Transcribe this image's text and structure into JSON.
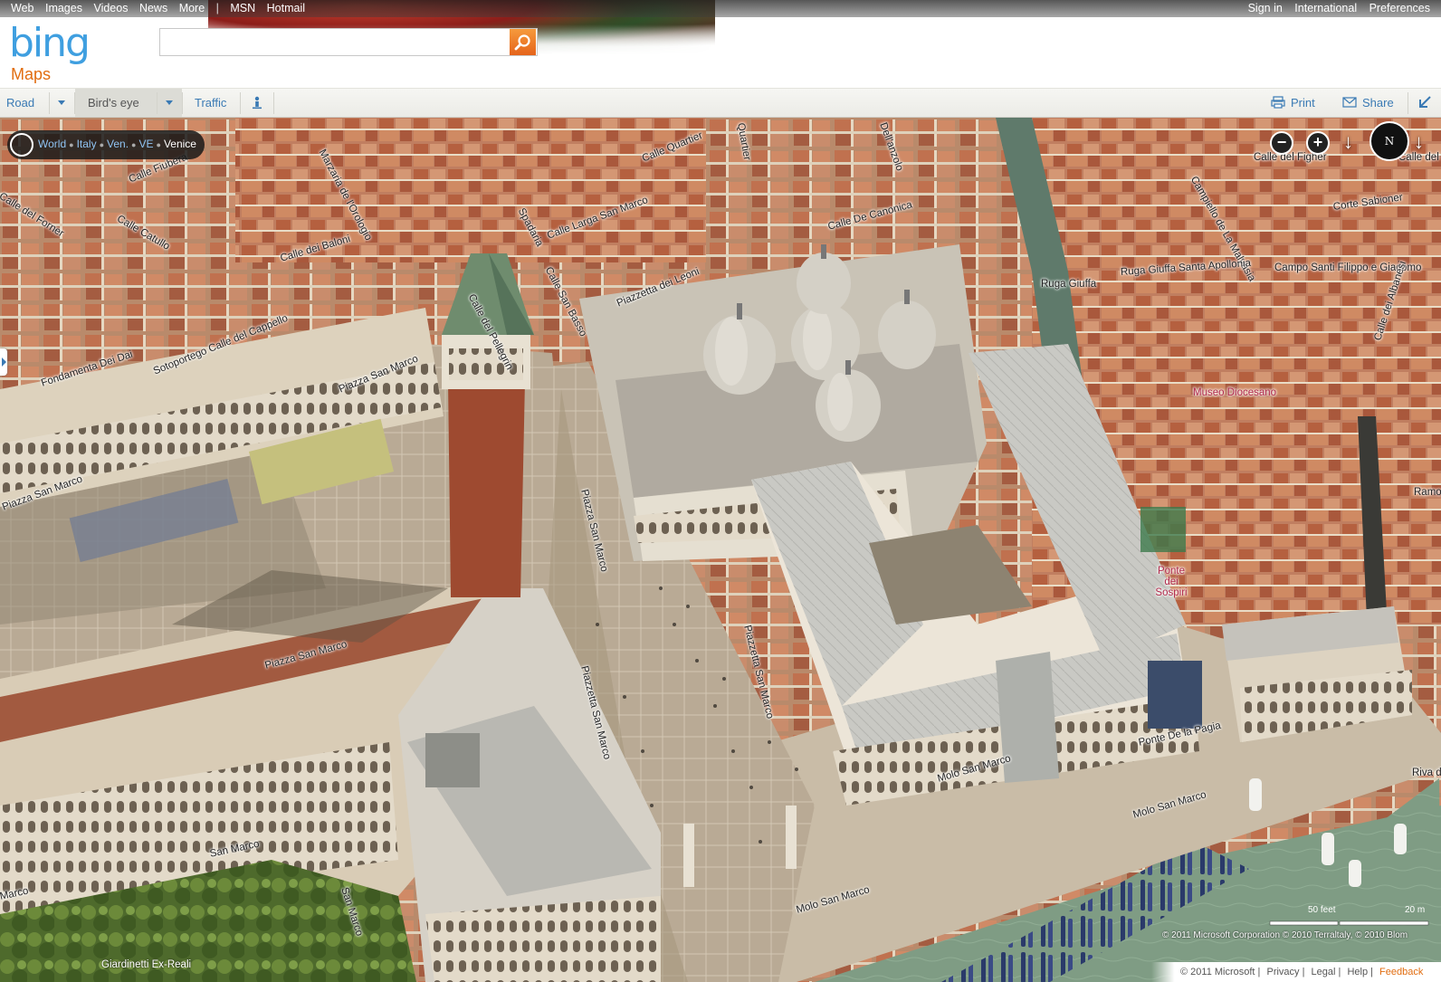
{
  "header": {
    "top_links_left": [
      "Web",
      "Images",
      "Videos",
      "News",
      "More",
      "|",
      "MSN",
      "Hotmail"
    ],
    "top_links_right": [
      "Sign in",
      "International",
      "Preferences"
    ],
    "logo": "bing",
    "product": "Maps",
    "search": {
      "value": "",
      "placeholder": ""
    }
  },
  "toolbar": {
    "road": "Road",
    "birdseye": "Bird's eye",
    "traffic": "Traffic",
    "print": "Print",
    "share": "Share"
  },
  "breadcrumb": {
    "items": [
      "World",
      "Italy",
      "Ven.",
      "VE"
    ],
    "current": "Venice"
  },
  "map": {
    "labels": [
      "Calle Fiubera",
      "Calle del Forner",
      "Calle Catullo",
      "Marzaria de l'Orologio",
      "Spadaria",
      "Calle Quartier",
      "Quartier",
      "Dell'anzolo",
      "Calle del Figher",
      "Calle del F",
      "Campiello de La Malvasia",
      "Corte Sabioner",
      "Calle dei Baloni",
      "Calle Larga San Marco",
      "Calle San Basso",
      "Calle De Canonica",
      "Ruga Giuffa",
      "Ruga Giuffa Santa Apollonia",
      "Campo Santi Filippo e Giacomo",
      "Calle del Pellegrin",
      "Piazzetta dei Leoni",
      "Sotoportego Calle del Cappello",
      "Fondamenta Dei Dai",
      "Piazza San Marco",
      "Piazza San Marco",
      "Piazza San Marco",
      "Calle dei Albanesi",
      "Ramo D",
      "Piazza San Marco",
      "Piazzetta San Marco",
      "Piazzetta San Marco",
      "Ponte De la Pagia",
      "Molo San Marco",
      "Molo San Marco",
      "Riva de",
      "San Marco",
      "Marco",
      "San Marco",
      "Molo San Marco",
      "Giardinetti Ex-Reali"
    ],
    "pois": [
      "Museo Diocesano",
      "Ponte dei Sospiri"
    ],
    "scale_feet": "50 feet",
    "scale_m": "20 m",
    "copyright": "© 2011 Microsoft Corporation   © 2010 Terraltaly, © 2010 Blom"
  },
  "footer": {
    "copyright": "© 2011 Microsoft",
    "links": [
      "Privacy",
      "Legal",
      "Help"
    ],
    "feedback": "Feedback"
  },
  "colors": {
    "accent": "#e16d10",
    "link": "#3a7ab4",
    "bing_blue": "#3f9fe0"
  },
  "icons": [
    "search-icon",
    "caret-down-icon",
    "pin-icon",
    "print-icon",
    "share-icon",
    "collapse-icon",
    "locate-icon",
    "zoom-out-icon",
    "zoom-in-icon",
    "rotate-left-icon",
    "compass-icon",
    "rotate-right-icon"
  ]
}
